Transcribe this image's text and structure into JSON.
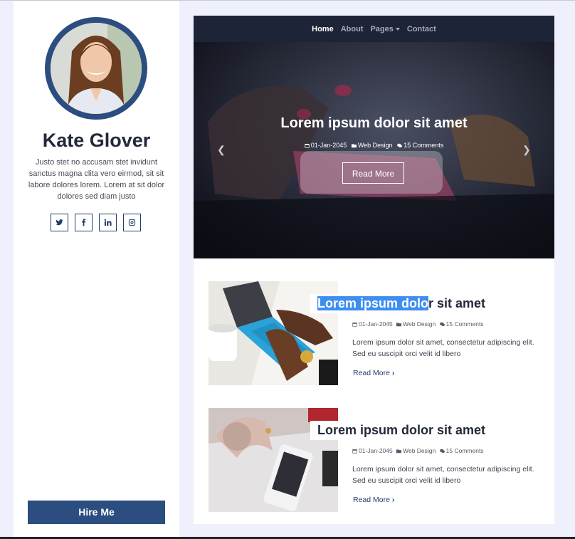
{
  "sidebar": {
    "name": "Kate Glover",
    "bio": "Justo stet no accusam stet invidunt sanctus magna clita vero eirmod, sit sit labore dolores lorem. Lorem at sit dolor dolores sed diam justo",
    "socials": [
      "twitter",
      "facebook",
      "linkedin",
      "instagram"
    ],
    "hire_label": "Hire Me"
  },
  "nav": {
    "items": [
      "Home",
      "About",
      "Pages",
      "Contact"
    ],
    "active": "Home"
  },
  "hero": {
    "title": "Lorem ipsum dolor sit amet",
    "date": "01-Jan-2045",
    "category": "Web Design",
    "comments": "15 Comments",
    "button": "Read More",
    "prev_icon": "chevron-left-icon",
    "next_icon": "chevron-right-icon"
  },
  "posts": [
    {
      "title_selected": "Lorem ipsum dolo",
      "title_rest": "r sit amet",
      "date": "01-Jan-2045",
      "category": "Web Design",
      "comments": "15 Comments",
      "excerpt": "Lorem ipsum dolor sit amet, consectetur adipiscing elit. Sed eu suscipit orci velit id libero",
      "read_more": "Read More"
    },
    {
      "title": "Lorem ipsum dolor sit amet",
      "date": "01-Jan-2045",
      "category": "Web Design",
      "comments": "15 Comments",
      "excerpt": "Lorem ipsum dolor sit amet, consectetur adipiscing elit. Sed eu suscipit orci velit id libero",
      "read_more": "Read More"
    }
  ],
  "colors": {
    "brand": "#2c4d7f",
    "nav_bg": "#1e2437",
    "page_bg": "#eef0fb",
    "selection": "#3d8ef0"
  }
}
